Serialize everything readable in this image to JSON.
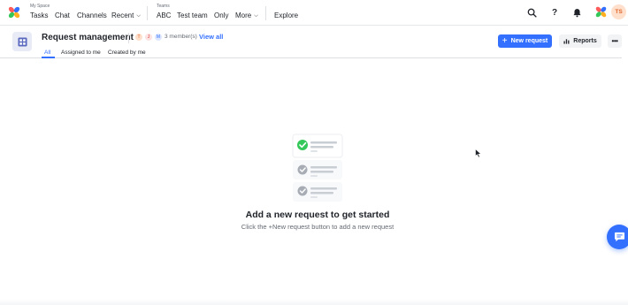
{
  "topnav": {
    "my_space_label": "My Space",
    "my_space_items": [
      {
        "label": "Tasks"
      },
      {
        "label": "Chat"
      },
      {
        "label": "Channels"
      },
      {
        "label": "Recent"
      }
    ],
    "teams_label": "Teams",
    "team_items": [
      {
        "label": "ABC"
      },
      {
        "label": "Test team"
      },
      {
        "label": "Only"
      },
      {
        "label": "More"
      }
    ],
    "explore_label": "Explore",
    "icons": [
      "search-icon",
      "help-icon",
      "bell-icon",
      "brand-icon"
    ],
    "user_initials": "TS"
  },
  "header": {
    "title": "Request management",
    "members": [
      {
        "initial": "T",
        "bg": "#ffe0cc",
        "fg": "#e0662d"
      },
      {
        "initial": "J",
        "bg": "#fde2e2",
        "fg": "#d83931"
      },
      {
        "initial": "M",
        "bg": "#dde7ff",
        "fg": "#3370ff"
      }
    ],
    "member_count": "3 member(s)",
    "view_all": "View all",
    "new_request_label": "New request",
    "reports_label": "Reports"
  },
  "tabs": [
    {
      "label": "All",
      "active": true
    },
    {
      "label": "Assigned to me",
      "active": false
    },
    {
      "label": "Created by me",
      "active": false
    }
  ],
  "empty_state": {
    "title": "Add a new request to get started",
    "subtitle": "Click the +New request button to add a new request"
  },
  "colors": {
    "accent": "#3370ff",
    "success": "#34c759",
    "muted": "#8f959e"
  }
}
